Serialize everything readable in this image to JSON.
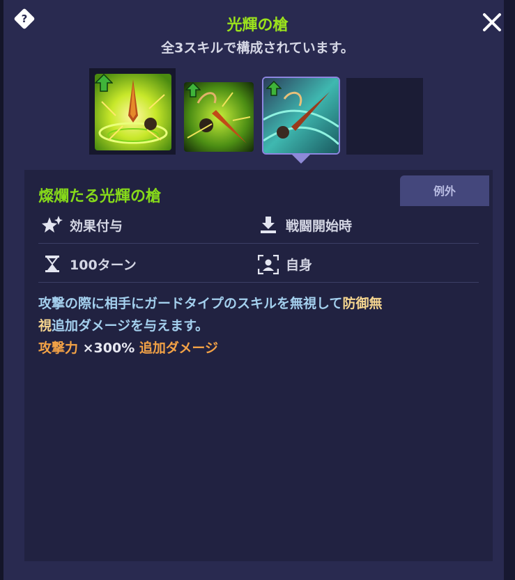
{
  "header": {
    "title": "光輝の槍",
    "subtitle": "全3スキルで構成されています。"
  },
  "skill": {
    "name": "燦爛たる光輝の槍",
    "tag": "例外",
    "effect_type": "効果付与",
    "trigger": "戦闘開始時",
    "duration": "100ターン",
    "target": "自身",
    "description": {
      "line1_main": "攻撃の際に相手にガードタイプのスキルを無視して",
      "line1_highlight": "防御無",
      "line2_highlight": "視",
      "line2_main": "追加ダメージを与えます。",
      "line3_stat": "攻撃力",
      "line3_value": "×300%",
      "line3_suffix": "追加ダメージ"
    }
  },
  "icons": {
    "help": "help-icon",
    "close": "close-icon",
    "effect": "sparkle-icon",
    "trigger": "download-tray-icon",
    "duration": "hourglass-icon",
    "target": "person-frame-icon",
    "upgrade": "green-up-arrow-icon"
  },
  "colors": {
    "title": "#9be21c",
    "skill_name": "#86d91a",
    "description": "#a4d0ee",
    "highlight": "#f5d58f",
    "damage": "#f3a246",
    "panel": "#292a50"
  }
}
